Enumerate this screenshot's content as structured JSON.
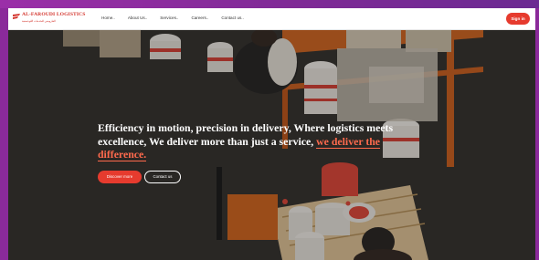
{
  "brand": {
    "name": "AL-FAROUDI LOGISTICS",
    "tagline": "الفاروضي للخدمات اللوجستية",
    "accent_color": "#e63b2e"
  },
  "nav": {
    "links": [
      "Home..",
      "About Us..",
      "Services..",
      "Careers..",
      "Contact us.."
    ],
    "signin_label": "Sign in"
  },
  "hero": {
    "headline_main": "Efficiency in motion, precision in delivery, Where logistics meets excellence, We deliver more than just a service, ",
    "headline_accent": "we deliver the difference.",
    "primary_cta": "Discover more",
    "secondary_cta": "Contact us"
  }
}
